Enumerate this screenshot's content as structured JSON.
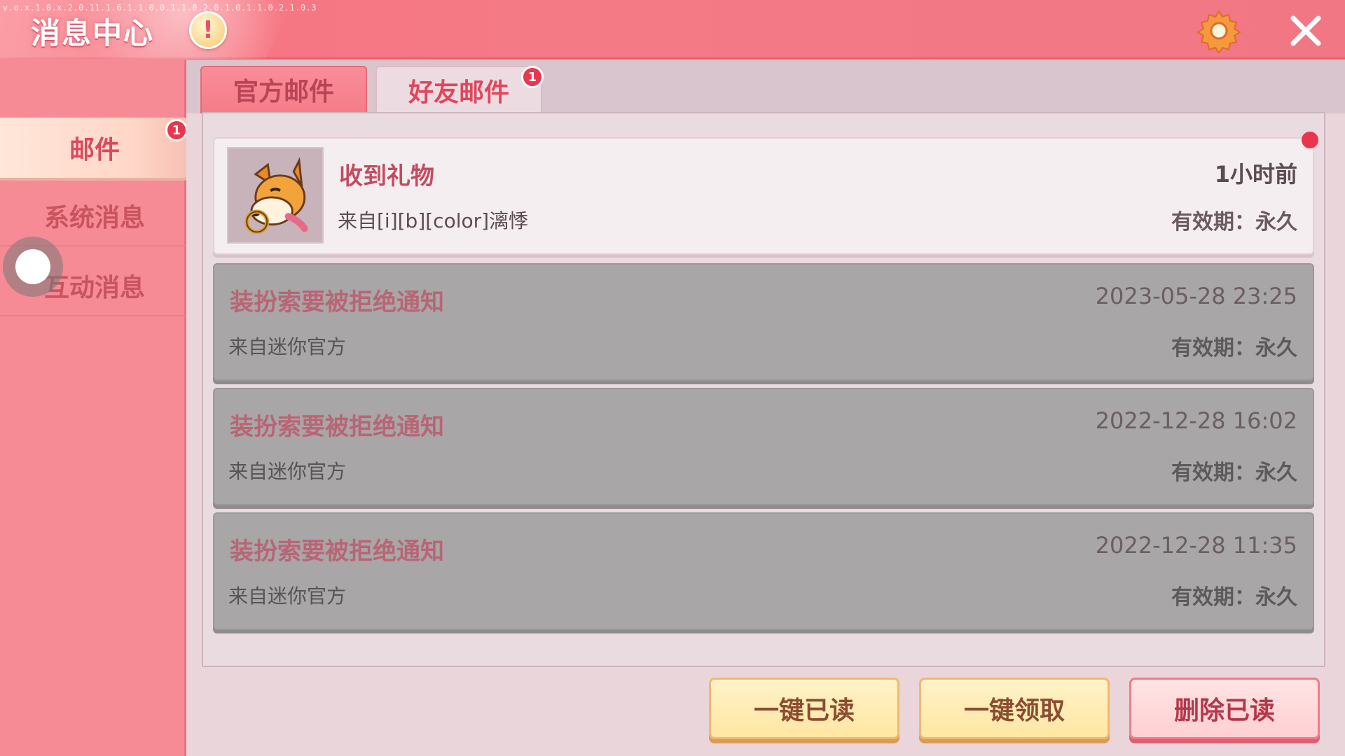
{
  "header": {
    "debug_text": "v.o.x.1.0.x.2.0.11.1.6.1.1.0.0.1.1.0.2.0.1.0.1.1.0.2.1.0.3",
    "title": "消息中心",
    "alert_glyph": "!",
    "icons": [
      "alert-icon",
      "gear-icon",
      "close-icon"
    ]
  },
  "sidebar": {
    "items": [
      {
        "label": "邮件",
        "active": true,
        "badge": "1"
      },
      {
        "label": "系统消息",
        "active": false
      },
      {
        "label": "互动消息",
        "active": false
      }
    ]
  },
  "tabs": [
    {
      "label": "官方邮件",
      "active": false
    },
    {
      "label": "好友邮件",
      "active": true,
      "badge": "1"
    }
  ],
  "mails": [
    {
      "title": "收到礼物",
      "sender": "来自[i][b][color]漓悸",
      "time": "1小时前",
      "expiry": "有效期：永久",
      "read": false,
      "avatar": "shiba-dog-avatar"
    },
    {
      "title": "装扮索要被拒绝通知",
      "sender": "来自迷你官方",
      "time": "2023-05-28 23:25",
      "expiry": "有效期：永久",
      "read": true
    },
    {
      "title": "装扮索要被拒绝通知",
      "sender": "来自迷你官方",
      "time": "2022-12-28 16:02",
      "expiry": "有效期：永久",
      "read": true
    },
    {
      "title": "装扮索要被拒绝通知",
      "sender": "来自迷你官方",
      "time": "2022-12-28 11:35",
      "expiry": "有效期：永久",
      "read": true
    }
  ],
  "buttons": {
    "mark_all_read": "一键已读",
    "claim_all": "一键领取",
    "delete_read": "删除已读"
  },
  "colors": {
    "header": "#f47a86",
    "accent_red": "#e8364e",
    "button_yellow": "#ffe7a3",
    "button_pink": "#ffd0d3"
  }
}
